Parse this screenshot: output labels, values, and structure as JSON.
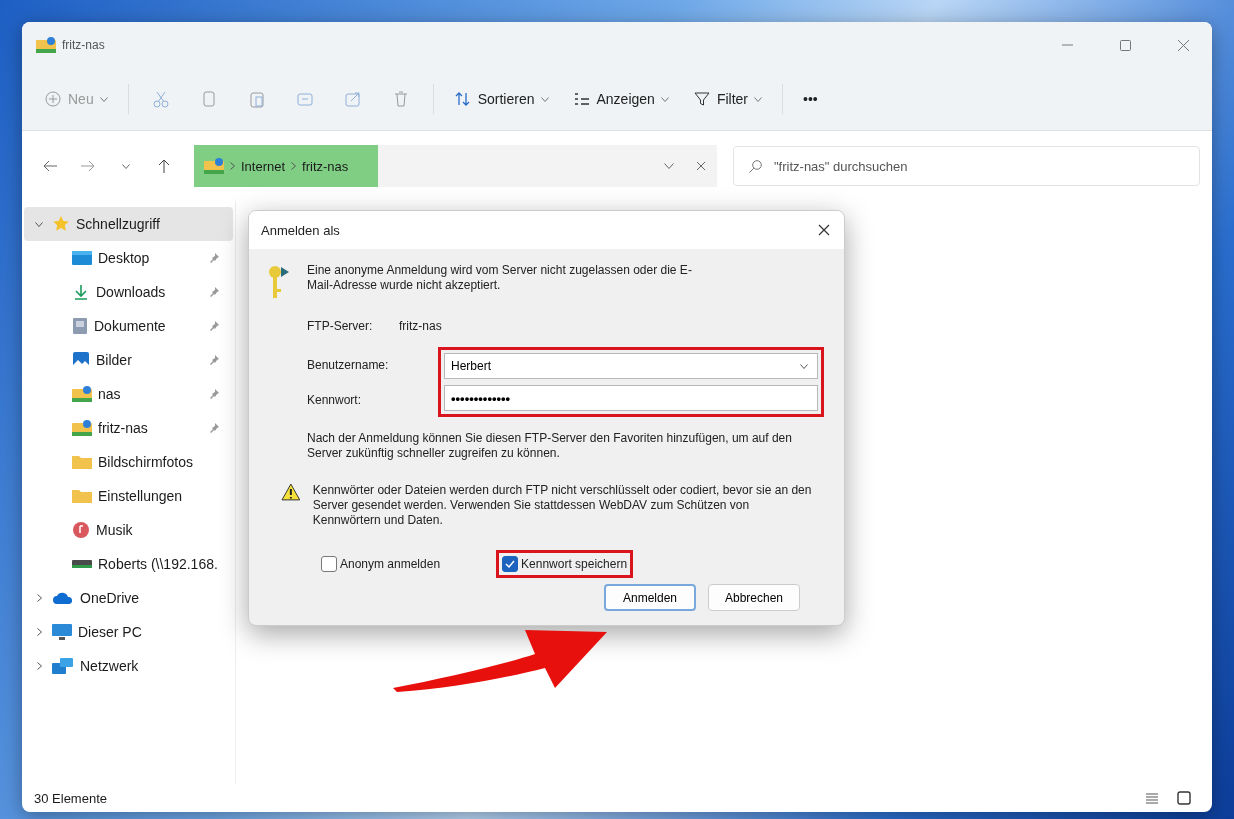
{
  "window": {
    "title": "fritz-nas"
  },
  "toolbar": [
    {
      "label": "Neu",
      "kind": "new",
      "disabled": true
    },
    {
      "label": "Sortieren",
      "kind": "sort",
      "disabled": false
    },
    {
      "label": "Anzeigen",
      "kind": "view",
      "disabled": false
    },
    {
      "label": "Filter",
      "kind": "filter",
      "disabled": false
    },
    {
      "label": "•••",
      "kind": "more",
      "disabled": false
    }
  ],
  "address": {
    "path": [
      "Internet",
      "fritz-nas"
    ],
    "search_placeholder": "\"fritz-nas\" durchsuchen"
  },
  "sidebar": {
    "items": [
      {
        "label": "Schnellzugriff",
        "kind": "star",
        "expanded": true,
        "selected": true,
        "children": [
          {
            "label": "Desktop",
            "kind": "desktop",
            "pinned": true
          },
          {
            "label": "Downloads",
            "kind": "download",
            "pinned": true
          },
          {
            "label": "Dokumente",
            "kind": "document",
            "pinned": true
          },
          {
            "label": "Bilder",
            "kind": "pictures",
            "pinned": true
          },
          {
            "label": "nas",
            "kind": "netfolder",
            "pinned": true
          },
          {
            "label": "fritz-nas",
            "kind": "netfolder",
            "pinned": true
          },
          {
            "label": "Bildschirmfotos",
            "kind": "folder",
            "pinned": false
          },
          {
            "label": "Einstellungen",
            "kind": "folder",
            "pinned": false
          },
          {
            "label": "Musik",
            "kind": "music",
            "pinned": false
          },
          {
            "label": "Roberts (\\\\192.168.",
            "kind": "drive",
            "pinned": false
          }
        ]
      },
      {
        "label": "OneDrive",
        "kind": "cloud",
        "expanded": false,
        "selected": false
      },
      {
        "label": "Dieser PC",
        "kind": "pc",
        "expanded": false,
        "selected": false
      },
      {
        "label": "Netzwerk",
        "kind": "network",
        "expanded": false,
        "selected": false
      }
    ]
  },
  "dialog": {
    "title": "Anmelden als",
    "message": "Eine anonyme Anmeldung wird vom Server nicht zugelassen oder die E-Mail-Adresse wurde nicht akzeptiert.",
    "server_label": "FTP-Server:",
    "server_value": "fritz-nas",
    "username_label": "Benutzername:",
    "username": "Herbert",
    "password_label": "Kennwort:",
    "password": "•••••••••••••",
    "info": "Nach der Anmeldung können Sie diesen FTP-Server den Favoriten hinzufügen, um auf den Server zukünftig schneller zugreifen zu können.",
    "warning": "Kennwörter oder Dateien werden durch FTP nicht verschlüsselt oder codiert, bevor sie an den Server gesendet werden. Verwenden Sie stattdessen WebDAV zum Schützen von Kennwörtern und Daten.",
    "checkboxes": [
      {
        "label": "Anonym anmelden",
        "checked": false,
        "highlighted": false
      },
      {
        "label": "Kennwort speichern",
        "checked": true,
        "highlighted": true
      }
    ],
    "buttons": [
      {
        "label": "Anmelden",
        "default": true
      },
      {
        "label": "Abbrechen",
        "default": false
      }
    ]
  },
  "status_bar": {
    "count": "30 Elemente"
  }
}
